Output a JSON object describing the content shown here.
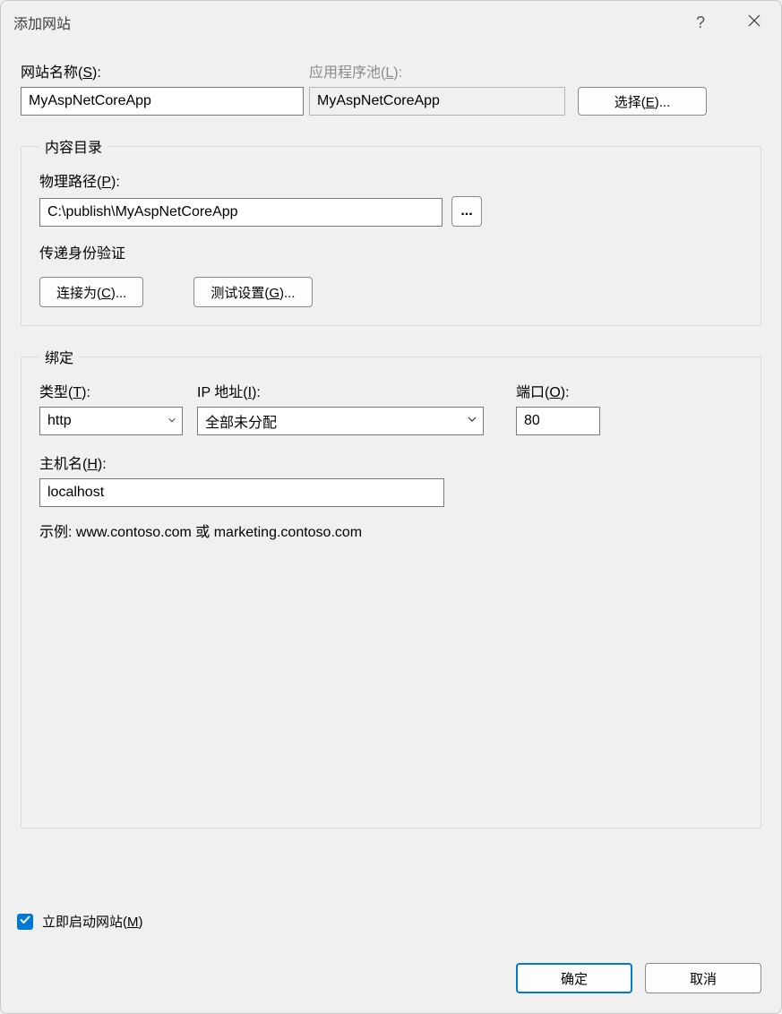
{
  "window": {
    "title": "添加网站",
    "help": "?",
    "close": "×"
  },
  "labels": {
    "site_name": "网站名称(",
    "site_name_key": "S",
    "site_name_end": "):",
    "app_pool": "应用程序池(",
    "app_pool_key": "L",
    "app_pool_end": "):",
    "select_btn": "选择(",
    "select_btn_key": "E",
    "select_btn_end": ")...",
    "content_dir": "内容目录",
    "physical_path": "物理路径(",
    "physical_path_key": "P",
    "physical_path_end": "):",
    "browse": "...",
    "passthrough": "传递身份验证",
    "connect_as": "连接为(",
    "connect_as_key": "C",
    "connect_as_end": ")...",
    "test_settings": "测试设置(",
    "test_settings_key": "G",
    "test_settings_end": ")...",
    "binding": "绑定",
    "type": "类型(",
    "type_key": "T",
    "type_end": "):",
    "ip_address": "IP 地址(",
    "ip_address_key": "I",
    "ip_address_end": "):",
    "port": "端口(",
    "port_key": "O",
    "port_end": "):",
    "host_name": "主机名(",
    "host_name_key": "H",
    "host_name_end": "):",
    "example": "示例: www.contoso.com 或 marketing.contoso.com",
    "start_immediately": "立即启动网站(",
    "start_immediately_key": "M",
    "start_immediately_end": ")",
    "ok": "确定",
    "cancel": "取消"
  },
  "values": {
    "site_name": "MyAspNetCoreApp",
    "app_pool": "MyAspNetCoreApp",
    "physical_path": "C:\\publish\\MyAspNetCoreApp",
    "type": "http",
    "ip_address": "全部未分配",
    "port": "80",
    "host_name": "localhost",
    "start_immediately_checked": true
  }
}
